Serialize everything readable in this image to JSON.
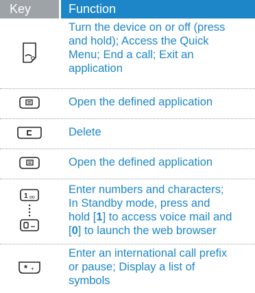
{
  "header": {
    "key": "Key",
    "function": "Function"
  },
  "rows": [
    {
      "icon": "power-end-key-icon",
      "lines": [
        "Turn the device on or off (press",
        "and hold); Access the Quick",
        "Menu; End a call; Exit an",
        "application"
      ]
    },
    {
      "icon": "left-softkey-icon",
      "lines": [
        "Open the defined application"
      ]
    },
    {
      "icon": "clear-key-icon",
      "lines": [
        "Delete"
      ]
    },
    {
      "icon": "right-softkey-icon",
      "lines": [
        "Open the defined application"
      ]
    },
    {
      "icon": "alphanumeric-keys-icon",
      "lines": [
        "Enter numbers and characters;",
        "In Standby mode, press and"
      ],
      "line3": {
        "a": "hold [",
        "b": "1",
        "c": "] to access voice mail and"
      },
      "line4": {
        "a": "[",
        "b": "0",
        "c": "] to launch the web browser"
      }
    },
    {
      "icon": "star-key-icon",
      "lines": [
        "Enter an international call prefix",
        "or pause; Display a list of",
        "symbols"
      ]
    }
  ],
  "colors": {
    "header_key_bg": "#9ea3a8",
    "header_function_bg": "#1c86c8",
    "text": "#1c86c8"
  }
}
